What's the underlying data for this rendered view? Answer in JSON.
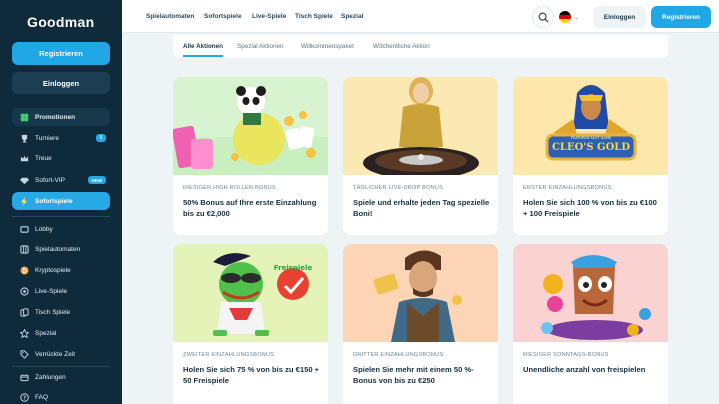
{
  "brand": {
    "logo": "Goodman",
    "accent": "#1fa7e6",
    "sidebar_bg": "#0e2a3b"
  },
  "sidebar": {
    "register_label": "Registrieren",
    "login_label": "Einloggen",
    "items": [
      {
        "label": "Promotionen",
        "icon": "clover-icon"
      },
      {
        "label": "Turniere",
        "icon": "trophy-icon",
        "badge": "6"
      },
      {
        "label": "Treue",
        "icon": "crown-icon"
      },
      {
        "label": "Sofort-VIP",
        "icon": "diamond-icon",
        "badge": "NEW"
      },
      {
        "label": "Sofortspiele",
        "icon": "lightning-icon"
      },
      {
        "label": "Lobby",
        "icon": "lobby-icon"
      },
      {
        "label": "Spielautomaten",
        "icon": "slot-icon"
      },
      {
        "label": "Kryptospiele",
        "icon": "bitcoin-icon"
      },
      {
        "label": "Live-Spiele",
        "icon": "live-icon"
      },
      {
        "label": "Tisch Spiele",
        "icon": "cards-icon"
      },
      {
        "label": "Spezial",
        "icon": "star-icon"
      },
      {
        "label": "Verrückte Zeit",
        "icon": "tag-icon"
      },
      {
        "label": "Zahlungen",
        "icon": "wallet-icon"
      },
      {
        "label": "FAQ",
        "icon": "help-icon"
      }
    ]
  },
  "header": {
    "links": [
      "Spielautomaten",
      "Sofortspiele",
      "Live-Spiele",
      "Tisch Spiele",
      "Spezial"
    ],
    "login_label": "Einloggen",
    "register_label": "Registrieren"
  },
  "tabs": [
    "Alle Aktionen",
    "Spezial Aktionen",
    "Willkommenspaket",
    "Wöchentliche Aktion"
  ],
  "cards": [
    {
      "kicker": "RIESIGER HIGH ROLLER BONUS",
      "title": "50% Bonus auf Ihre erste Einzahlung bis zu €2,000",
      "bg": "#d8f3d0"
    },
    {
      "kicker": "TÄGLICHER LIVE-DROP BONUS",
      "title": "Spiele und erhalte jeden Tag spezielle Boni!",
      "bg": "#fbe9b4"
    },
    {
      "kicker": "ERSTER EINZAHLUNGSBONUS",
      "title": "Holen Sie sich 100 % von bis zu €100 + 100 Freispiele",
      "bg": "#fde7ab",
      "logo_text": [
        "FEATURED SLOT GAME",
        "CLEO'S GOLD"
      ]
    },
    {
      "kicker": "ZWEITER EINZAHLUNGSBONUS",
      "title": "Holen Sie sich 75 % von bis zu €150 + 50 Freispiele",
      "bg": "#e5f3b8",
      "sign_text": "Freispiele"
    },
    {
      "kicker": "DRITTER EINZAHLUNGSBONUS",
      "title": "Spielen Sie mehr mit einem 50 %-Bonus von bis zu €250",
      "bg": "#fbd5b5"
    },
    {
      "kicker": "RIESIGER SONNTAGS-BONUS",
      "title": "Unendliche anzahl von freispielen",
      "bg": "#fbd2d2"
    }
  ]
}
